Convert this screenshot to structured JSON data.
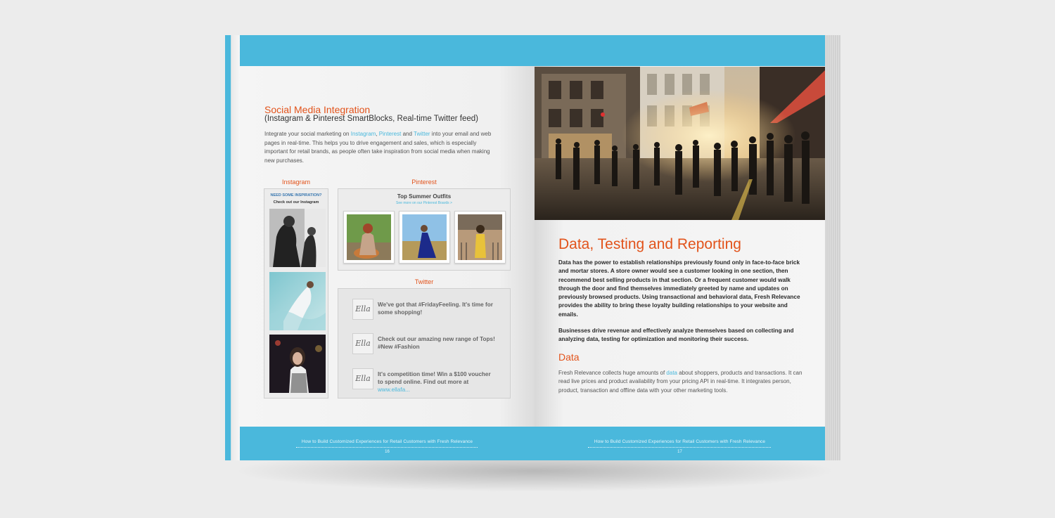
{
  "left_page": {
    "heading": "Social Media Integration",
    "subheading": "(Instagram & Pinterest SmartBlocks, Real-time Twitter feed)",
    "intro_before": "Integrate your social marketing on ",
    "link_instagram": "Instagram",
    "sep_comma": ", ",
    "link_pinterest": "Pinterest",
    "and_word": " and ",
    "link_twitter": "Twitter",
    "intro_after": " into your email and web pages in real-time. This helps you to drive engagement and sales, which is especially important for retail brands, as people often take inspiration from social media when making new purchases.",
    "instagram": {
      "label": "Instagram",
      "header_line1": "NEED SOME INSPIRATION?",
      "header_line2": "Check out our Instagram"
    },
    "pinterest": {
      "label": "Pinterest",
      "title": "Top Summer Outfits",
      "subtitle": "See more on our Pinterest Boards >"
    },
    "twitter": {
      "label": "Twitter",
      "avatar_text": "Ella",
      "tweets": [
        {
          "text": "We've got that #FridayFeeling. It's time for some shopping!"
        },
        {
          "text": "Check out our amazing new range of Tops! #New #Fashion"
        },
        {
          "text_before": "It's competition time! Win a $100 voucher to spend online. Find out more at ",
          "link": "www.ellafa..."
        }
      ]
    },
    "footer": "How to Build Customized Experiences for Retail Customers with Fresh Relevance",
    "page_number": "16"
  },
  "right_page": {
    "heading": "Data, Testing and Reporting",
    "para1": "Data has the power to establish relationships previously found only in face-to-face brick and mortar stores. A store owner would see a customer looking in one section, then recommend best selling products in that section. Or a frequent customer would walk through the door and find themselves immediately greeted by name and updates on previously browsed products. Using transactional and behavioral data, Fresh Relevance provides the ability to bring these loyalty building relationships to your website and emails.",
    "para2": "Businesses drive revenue and effectively analyze themselves based on collecting and analyzing data, testing for optimization and monitoring their success.",
    "subheading": "Data",
    "data_before": "Fresh Relevance collects huge amounts of ",
    "data_link": "data",
    "data_after": " about shoppers, products and transactions. It can read live prices and product availability from your pricing API in real-time. It integrates person, product, transaction and offline data with your other marketing tools.",
    "footer": "How to Build Customized Experiences for Retail Customers with Fresh Relevance",
    "page_number": "17"
  },
  "colors": {
    "accent_blue": "#4ab8dc",
    "heading_orange": "#e2531b"
  }
}
